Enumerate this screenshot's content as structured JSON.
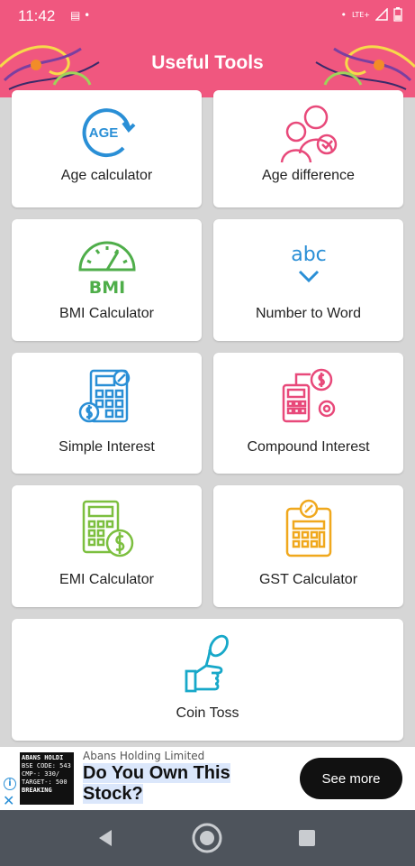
{
  "status_bar": {
    "time": "11:42",
    "network": "LTE+"
  },
  "header": {
    "title": "Useful Tools"
  },
  "tools": [
    {
      "label": "Age calculator",
      "icon": "age-icon"
    },
    {
      "label": "Age difference",
      "icon": "people-icon"
    },
    {
      "label": "BMI Calculator",
      "icon": "bmi-gauge-icon",
      "icon_text": "BMI"
    },
    {
      "label": "Number to Word",
      "icon": "abc-icon",
      "icon_text": "abc"
    },
    {
      "label": "Simple Interest",
      "icon": "calculator-percent-icon"
    },
    {
      "label": "Compound Interest",
      "icon": "calculator-coins-icon"
    },
    {
      "label": "EMI Calculator",
      "icon": "calculator-dollar-icon"
    },
    {
      "label": "GST Calculator",
      "icon": "calculator-gst-icon"
    },
    {
      "label": "Coin Toss",
      "icon": "thumb-coin-icon"
    }
  ],
  "age_icon_text": "AGE",
  "ad": {
    "sponsor": "Abans Holding Limited",
    "headline_line1": "Do You Own This",
    "headline_line2": "Stock?",
    "cta": "See more",
    "thumb_lines": [
      "ABANS HOLDI",
      "BSE CODE: 543",
      "CMP-: 330/",
      "TARGET-: 500",
      "BREAKING"
    ]
  }
}
